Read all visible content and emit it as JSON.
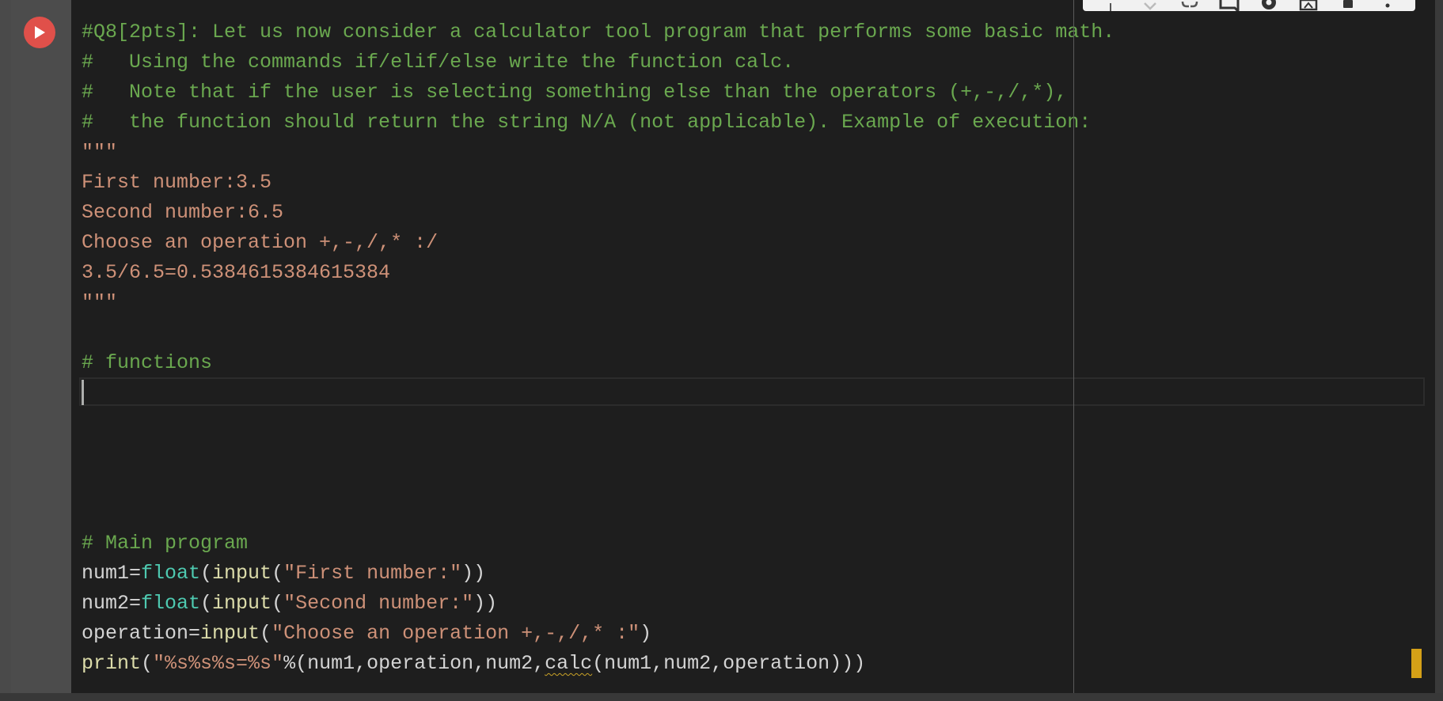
{
  "cell": {
    "run_button_label": "Run cell",
    "run_icon": "play-icon"
  },
  "toolbar": {
    "icons": [
      "arrow-up-icon",
      "arrow-down-icon",
      "link-icon",
      "comment-icon",
      "gear-icon",
      "mirror-cell-icon",
      "delete-icon",
      "more-vert-icon"
    ]
  },
  "code": {
    "lines": [
      [
        {
          "t": "#Q8[2pts]: Let us now consider a calculator tool program that performs some basic math.",
          "k": "comment"
        }
      ],
      [
        {
          "t": "#   Using the commands if/elif/else write the function calc.",
          "k": "comment"
        }
      ],
      [
        {
          "t": "#   Note that if the user is selecting something else than the operators (+,-,/,*),",
          "k": "comment"
        }
      ],
      [
        {
          "t": "#   the function should return the string N/A (not applicable). Example of execution:",
          "k": "comment"
        }
      ],
      [
        {
          "t": "\"\"\"",
          "k": "string"
        }
      ],
      [
        {
          "t": "First number:3.5",
          "k": "string"
        }
      ],
      [
        {
          "t": "Second number:6.5",
          "k": "string"
        }
      ],
      [
        {
          "t": "Choose an operation +,-,/,* :/",
          "k": "string"
        }
      ],
      [
        {
          "t": "3.5/6.5=0.5384615384615384",
          "k": "string"
        }
      ],
      [
        {
          "t": "\"\"\"",
          "k": "string"
        }
      ],
      [
        {
          "t": "",
          "k": "plain"
        }
      ],
      [
        {
          "t": "# functions",
          "k": "comment"
        }
      ],
      [
        {
          "t": "",
          "k": "plain"
        }
      ],
      [
        {
          "t": "",
          "k": "plain"
        }
      ],
      [
        {
          "t": "",
          "k": "plain"
        }
      ],
      [
        {
          "t": "",
          "k": "plain"
        }
      ],
      [
        {
          "t": "",
          "k": "plain"
        }
      ],
      [
        {
          "t": "# Main program",
          "k": "comment"
        }
      ],
      [
        {
          "t": "num1=",
          "k": "plain"
        },
        {
          "t": "float",
          "k": "builtin"
        },
        {
          "t": "(",
          "k": "plain"
        },
        {
          "t": "input",
          "k": "func"
        },
        {
          "t": "(",
          "k": "plain"
        },
        {
          "t": "\"First number:\"",
          "k": "string"
        },
        {
          "t": "))",
          "k": "plain"
        }
      ],
      [
        {
          "t": "num2=",
          "k": "plain"
        },
        {
          "t": "float",
          "k": "builtin"
        },
        {
          "t": "(",
          "k": "plain"
        },
        {
          "t": "input",
          "k": "func"
        },
        {
          "t": "(",
          "k": "plain"
        },
        {
          "t": "\"Second number:\"",
          "k": "string"
        },
        {
          "t": "))",
          "k": "plain"
        }
      ],
      [
        {
          "t": "operation=",
          "k": "plain"
        },
        {
          "t": "input",
          "k": "func"
        },
        {
          "t": "(",
          "k": "plain"
        },
        {
          "t": "\"Choose an operation +,-,/,* :\"",
          "k": "string"
        },
        {
          "t": ")",
          "k": "plain"
        }
      ],
      [
        {
          "t": "print",
          "k": "func"
        },
        {
          "t": "(",
          "k": "plain"
        },
        {
          "t": "\"%s%s%s=%s\"",
          "k": "string"
        },
        {
          "t": "%(num1,operation,num2,",
          "k": "plain"
        },
        {
          "t": "calc",
          "k": "squiggle"
        },
        {
          "t": "(num1,num2,operation)))",
          "k": "plain"
        }
      ]
    ]
  }
}
